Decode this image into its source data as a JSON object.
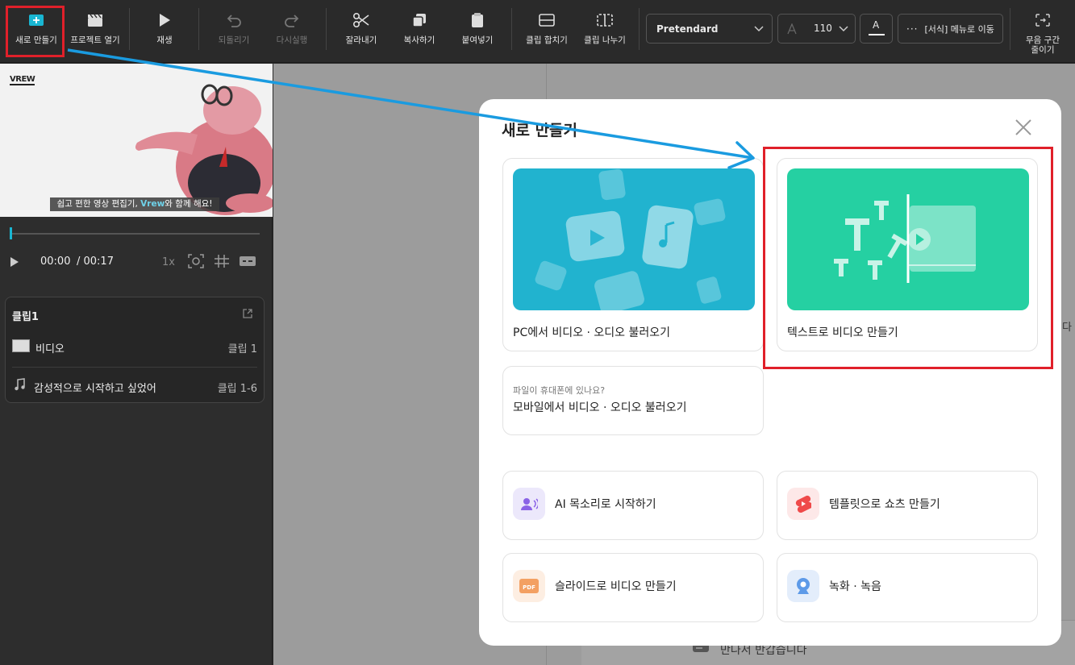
{
  "toolbar": {
    "new_label": "새로 만들기",
    "open_label": "프로젝트 열기",
    "play_label": "재생",
    "undo_label": "되돌리기",
    "redo_label": "다시실행",
    "cut_label": "잘라내기",
    "copy_label": "복사하기",
    "paste_label": "붙여넣기",
    "merge_label": "클립 합치기",
    "split_label": "클립 나누기",
    "font_value": "Pretendard",
    "size_value": "110",
    "color_glyph": "A",
    "format_label": "[서식] 메뉴로 이동",
    "silence_label_1": "무음 구간",
    "silence_label_2": "줄이기"
  },
  "preview": {
    "logo": "VREW",
    "caption_prefix": "쉽고 편한 영상 편집기, ",
    "caption_brand": "Vrew",
    "caption_suffix": "와 함께 해요!"
  },
  "player": {
    "current_time": "00:00",
    "total_time": "/ 00:17",
    "speed": "1x"
  },
  "clip_panel": {
    "title": "클립1",
    "rows": [
      {
        "icon": "video-thumb-icon",
        "label": "비디오",
        "range": "클립 1"
      },
      {
        "icon": "music-note-icon",
        "label": "감성적으로 시작하고 싶었어",
        "range": "클립 1-6"
      }
    ]
  },
  "background": {
    "subtitle_text": "만나서 반갑습니다",
    "edge_char": "다"
  },
  "modal": {
    "title": "새로 만들기",
    "cards": {
      "pc_import": "PC에서 비디오 · 오디오 불러오기",
      "text_to_video": "텍스트로 비디오 만들기",
      "mobile_hint": "파일이 휴대폰에 있나요?",
      "mobile_import": "모바일에서 비디오 · 오디오 불러오기"
    },
    "options": [
      {
        "label": "AI 목소리로 시작하기",
        "icon": "ai-voice-icon",
        "color": "#ece8fb"
      },
      {
        "label": "템플릿으로 쇼츠 만들기",
        "icon": "shorts-icon",
        "color": "#fde8e8"
      },
      {
        "label": "슬라이드로 비디오 만들기",
        "icon": "pdf-icon",
        "color": "#fdeee2"
      },
      {
        "label": "녹화 · 녹음",
        "icon": "webcam-icon",
        "color": "#e3edfb"
      }
    ]
  },
  "colors": {
    "highlight": "#e0202a",
    "arrow": "#1a9be0",
    "pc_card": "#21b3cf",
    "text_card": "#25d0a2",
    "brand": "#19b6d2"
  }
}
